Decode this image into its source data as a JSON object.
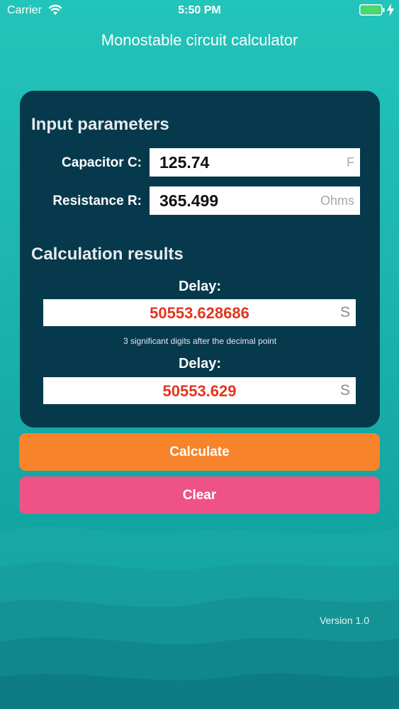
{
  "status_bar": {
    "carrier": "Carrier",
    "time": "5:50 PM",
    "battery_color": "#4cd964"
  },
  "app": {
    "title": "Monostable circuit calculator",
    "version": "Version 1.0"
  },
  "input_section": {
    "title": "Input parameters",
    "capacitor": {
      "label": "Capacitor C:",
      "value": "125.74",
      "unit": "F"
    },
    "resistance": {
      "label": "Resistance R:",
      "value": "365.499",
      "unit": "Ohms"
    }
  },
  "results_section": {
    "title": "Calculation results",
    "delay_full": {
      "label": "Delay:",
      "value": "50553.628686",
      "unit": "S"
    },
    "hint": "3 significant digits after the decimal point",
    "delay_rounded": {
      "label": "Delay:",
      "value": "50553.629",
      "unit": "S"
    }
  },
  "buttons": {
    "calculate": "Calculate",
    "clear": "Clear"
  },
  "colors": {
    "background": "#1db4ad",
    "panel": "#07394d",
    "calculate_button": "#f7832a",
    "clear_button": "#ee5286",
    "result_text": "#e0361e"
  },
  "icons": {
    "wifi": "wifi-icon",
    "battery": "battery-icon",
    "charging": "charging-bolt-icon"
  }
}
